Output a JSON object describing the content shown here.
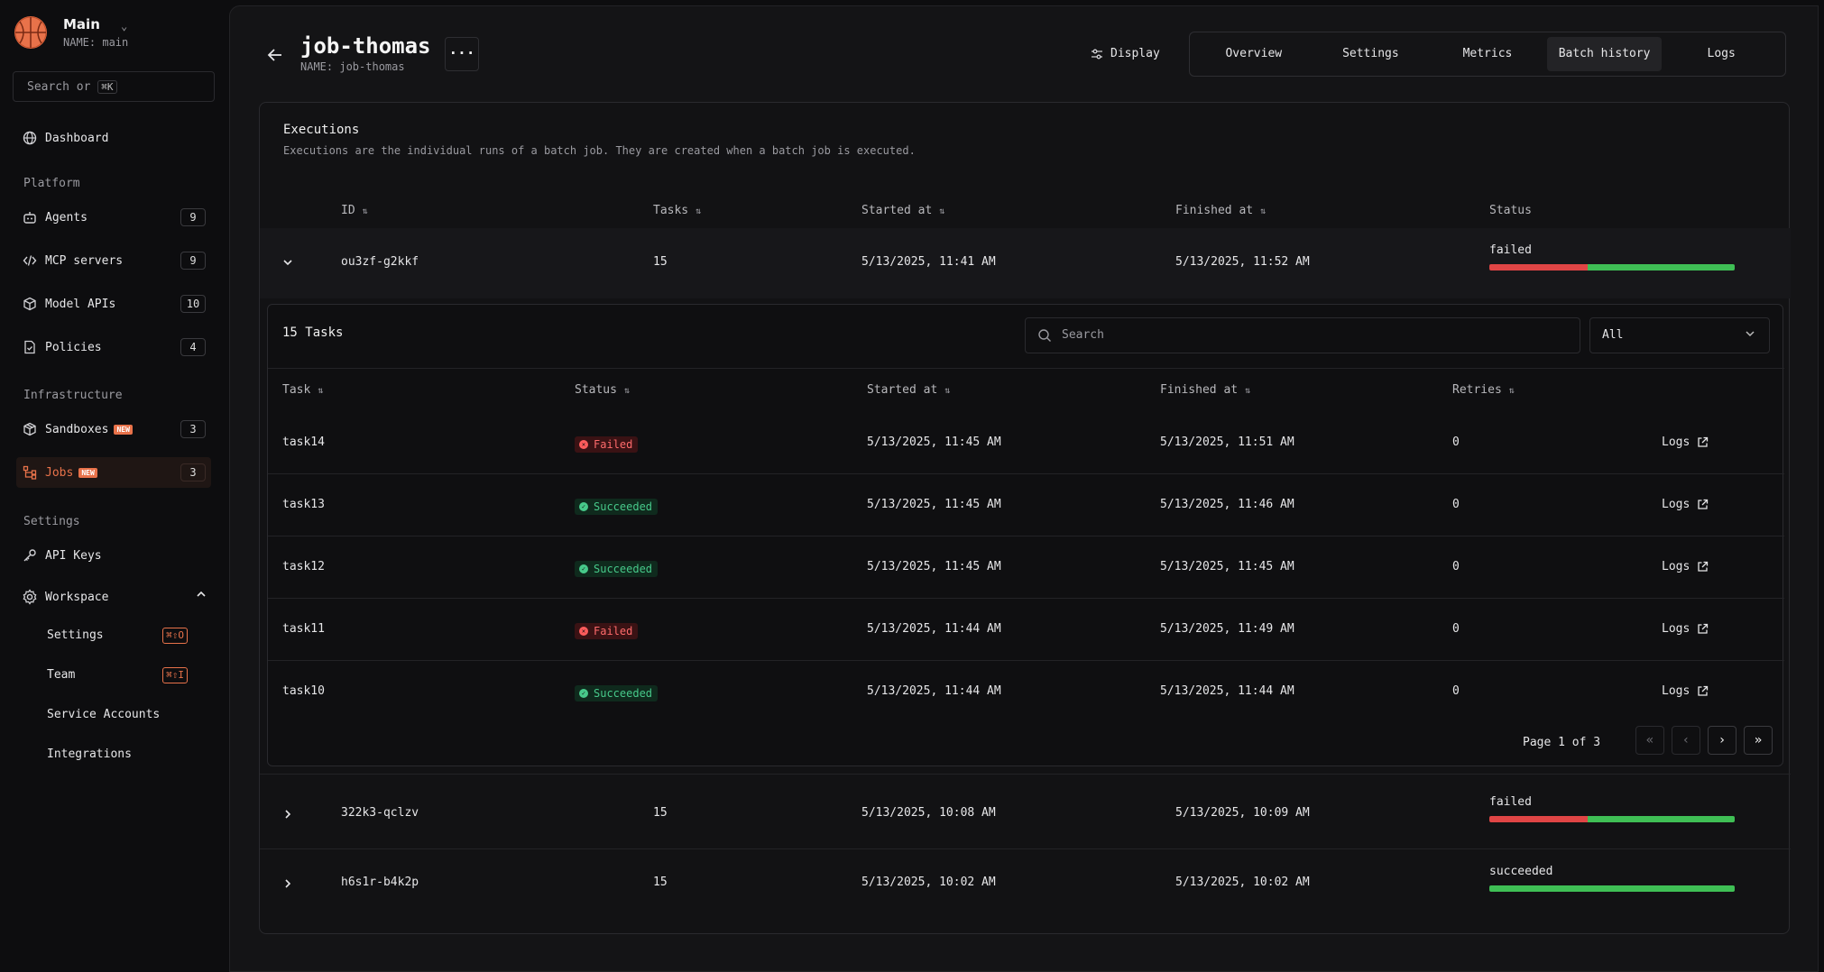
{
  "workspace": {
    "name": "Main",
    "sub": "NAME: main"
  },
  "search": {
    "label": "Search or",
    "shortcut": "⌘K"
  },
  "nav": {
    "dashboard": "Dashboard",
    "platform_section": "Platform",
    "agents": {
      "label": "Agents",
      "count": "9"
    },
    "mcp": {
      "label": "MCP servers",
      "count": "9"
    },
    "model_apis": {
      "label": "Model APIs",
      "count": "10"
    },
    "policies": {
      "label": "Policies",
      "count": "4"
    },
    "infra_section": "Infrastructure",
    "sandboxes": {
      "label": "Sandboxes",
      "badge": "NEW",
      "count": "3"
    },
    "jobs": {
      "label": "Jobs",
      "badge": "NEW",
      "count": "3"
    },
    "settings_section": "Settings",
    "api_keys": "API Keys",
    "workspace": "Workspace",
    "ws_settings": {
      "label": "Settings",
      "kbd": "⌘⇧O"
    },
    "ws_team": {
      "label": "Team",
      "kbd": "⌘⇧I"
    },
    "ws_service_accounts": "Service Accounts",
    "ws_integrations": "Integrations"
  },
  "header": {
    "title": "job-thomas",
    "subtitle": "NAME: job-thomas",
    "more": "···",
    "display": "Display",
    "tabs": [
      "Overview",
      "Settings",
      "Metrics",
      "Batch history",
      "Logs"
    ],
    "active_tab": "Batch history"
  },
  "executions": {
    "title": "Executions",
    "description": "Executions are the individual runs of a batch job. They are created when a batch job is executed.",
    "columns": [
      "ID",
      "Tasks",
      "Started at",
      "Finished at",
      "Status"
    ],
    "rows": [
      {
        "id": "ou3zf-g2kkf",
        "tasks": "15",
        "started": "5/13/2025, 11:41 AM",
        "finished": "5/13/2025, 11:52 AM",
        "status": "failed",
        "failed_fraction": 0.4,
        "expanded": true
      },
      {
        "id": "322k3-qclzv",
        "tasks": "15",
        "started": "5/13/2025, 10:08 AM",
        "finished": "5/13/2025, 10:09 AM",
        "status": "failed",
        "failed_fraction": 0.4,
        "expanded": false
      },
      {
        "id": "h6s1r-b4k2p",
        "tasks": "15",
        "started": "5/13/2025, 10:02 AM",
        "finished": "5/13/2025, 10:02 AM",
        "status": "succeeded",
        "failed_fraction": 0,
        "expanded": false
      }
    ]
  },
  "tasks_panel": {
    "title": "15 Tasks",
    "search_placeholder": "Search",
    "filter": "All",
    "columns": [
      "Task",
      "Status",
      "Started at",
      "Finished at",
      "Retries"
    ],
    "rows": [
      {
        "task": "task14",
        "status": "Failed",
        "started": "5/13/2025, 11:45 AM",
        "finished": "5/13/2025, 11:51 AM",
        "retries": "0",
        "link": "Logs"
      },
      {
        "task": "task13",
        "status": "Succeeded",
        "started": "5/13/2025, 11:45 AM",
        "finished": "5/13/2025, 11:46 AM",
        "retries": "0",
        "link": "Logs"
      },
      {
        "task": "task12",
        "status": "Succeeded",
        "started": "5/13/2025, 11:45 AM",
        "finished": "5/13/2025, 11:45 AM",
        "retries": "0",
        "link": "Logs"
      },
      {
        "task": "task11",
        "status": "Failed",
        "started": "5/13/2025, 11:44 AM",
        "finished": "5/13/2025, 11:49 AM",
        "retries": "0",
        "link": "Logs"
      },
      {
        "task": "task10",
        "status": "Succeeded",
        "started": "5/13/2025, 11:44 AM",
        "finished": "5/13/2025, 11:44 AM",
        "retries": "0",
        "link": "Logs"
      }
    ],
    "pagination": "Page 1 of 3"
  },
  "colors": {
    "accent": "#e8724a",
    "failed": "#e04545",
    "succeeded": "#3fbf55"
  }
}
